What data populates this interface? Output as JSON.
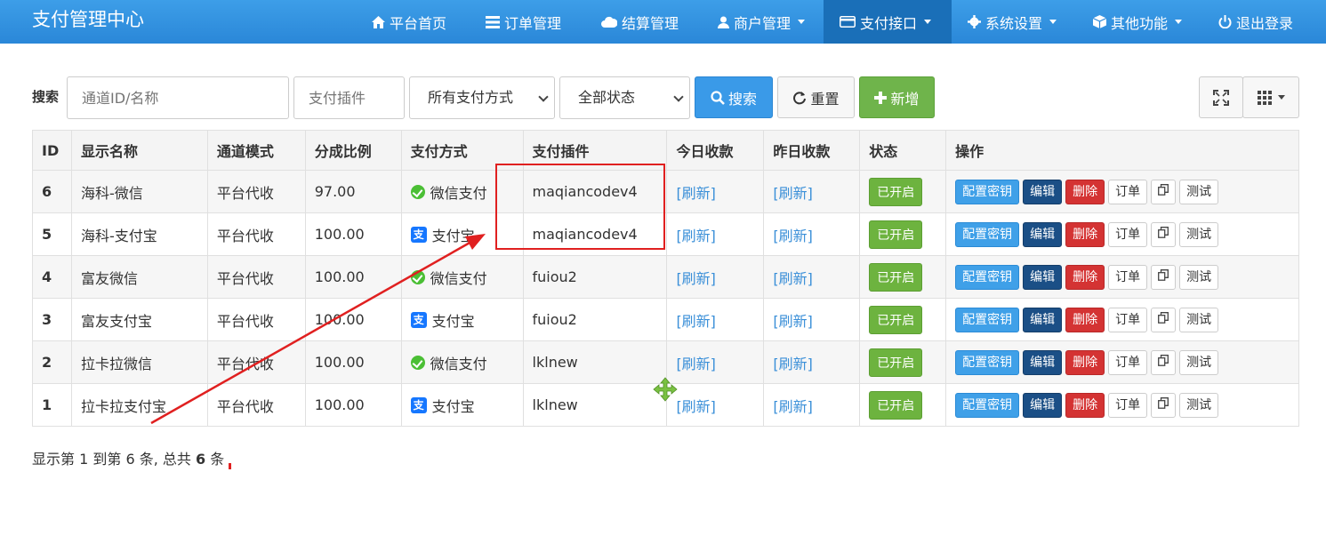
{
  "app": {
    "title": "支付管理中心"
  },
  "nav": [
    {
      "label": "平台首页",
      "icon": "home-icon"
    },
    {
      "label": "订单管理",
      "icon": "list-icon"
    },
    {
      "label": "结算管理",
      "icon": "cloud-icon"
    },
    {
      "label": "商户管理",
      "icon": "user-icon"
    },
    {
      "label": "支付接口",
      "icon": "credit-card-icon"
    },
    {
      "label": "系统设置",
      "icon": "gear-icon"
    },
    {
      "label": "其他功能",
      "icon": "cube-icon"
    },
    {
      "label": "退出登录",
      "icon": "power-icon"
    }
  ],
  "toolbar": {
    "search_label": "搜索",
    "channel_placeholder": "通道ID/名称",
    "plugin_placeholder": "支付插件",
    "paytype_selected": "所有支付方式",
    "status_selected": "全部状态",
    "search_btn": "搜索",
    "reset_btn": "重置",
    "add_btn": "新增"
  },
  "table": {
    "headers": [
      "ID",
      "显示名称",
      "通道模式",
      "分成比例",
      "支付方式",
      "支付插件",
      "今日收款",
      "昨日收款",
      "状态",
      "操作"
    ],
    "rows": [
      {
        "id": "6",
        "name": "海科-微信",
        "mode": "平台代收",
        "rate": "97.00",
        "paytype": "微信支付",
        "paykind": "wechat",
        "plugin": "maqiancodev4",
        "today": "[刷新]",
        "yesterday": "[刷新]",
        "status": "已开启"
      },
      {
        "id": "5",
        "name": "海科-支付宝",
        "mode": "平台代收",
        "rate": "100.00",
        "paytype": "支付宝",
        "paykind": "alipay",
        "plugin": "maqiancodev4",
        "today": "[刷新]",
        "yesterday": "[刷新]",
        "status": "已开启"
      },
      {
        "id": "4",
        "name": "富友微信",
        "mode": "平台代收",
        "rate": "100.00",
        "paytype": "微信支付",
        "paykind": "wechat",
        "plugin": "fuiou2",
        "today": "[刷新]",
        "yesterday": "[刷新]",
        "status": "已开启"
      },
      {
        "id": "3",
        "name": "富友支付宝",
        "mode": "平台代收",
        "rate": "100.00",
        "paytype": "支付宝",
        "paykind": "alipay",
        "plugin": "fuiou2",
        "today": "[刷新]",
        "yesterday": "[刷新]",
        "status": "已开启"
      },
      {
        "id": "2",
        "name": "拉卡拉微信",
        "mode": "平台代收",
        "rate": "100.00",
        "paytype": "微信支付",
        "paykind": "wechat",
        "plugin": "lklnew",
        "today": "[刷新]",
        "yesterday": "[刷新]",
        "status": "已开启"
      },
      {
        "id": "1",
        "name": "拉卡拉支付宝",
        "mode": "平台代收",
        "rate": "100.00",
        "paytype": "支付宝",
        "paykind": "alipay",
        "plugin": "lklnew",
        "today": "[刷新]",
        "yesterday": "[刷新]",
        "status": "已开启"
      }
    ],
    "ops": {
      "key": "配置密钥",
      "edit": "编辑",
      "del": "删除",
      "order": "订单",
      "test": "测试"
    }
  },
  "footer": {
    "p1": "显示第 1 到第 6 条, 总共 ",
    "total": "6",
    "p2": " 条"
  },
  "colors": {
    "nav": "#2a87d8",
    "accent": "#3a9ae8",
    "success": "#6fb44b",
    "danger": "#d43333",
    "annotation": "#e02020"
  }
}
